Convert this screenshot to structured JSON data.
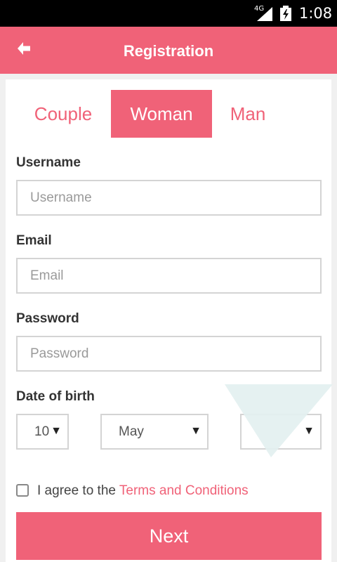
{
  "status_bar": {
    "network": "4G",
    "time": "1:08"
  },
  "app_bar": {
    "title": "Registration"
  },
  "tabs": [
    {
      "label": "Couple",
      "active": false
    },
    {
      "label": "Woman",
      "active": true
    },
    {
      "label": "Man",
      "active": false
    }
  ],
  "form": {
    "username": {
      "label": "Username",
      "placeholder": "Username",
      "value": ""
    },
    "email": {
      "label": "Email",
      "placeholder": "Email",
      "value": ""
    },
    "password": {
      "label": "Password",
      "placeholder": "Password",
      "value": ""
    },
    "dob": {
      "label": "Date of birth",
      "day": "10",
      "month": "May",
      "year": ""
    }
  },
  "agree": {
    "prefix": "I agree to the ",
    "link_text": "Terms and Conditions",
    "checked": false
  },
  "next_button": {
    "label": "Next"
  },
  "colors": {
    "accent": "#f06278",
    "background": "#f0f0f0",
    "field_border": "#d4d4d4",
    "overlay": "#e3f0f0"
  }
}
